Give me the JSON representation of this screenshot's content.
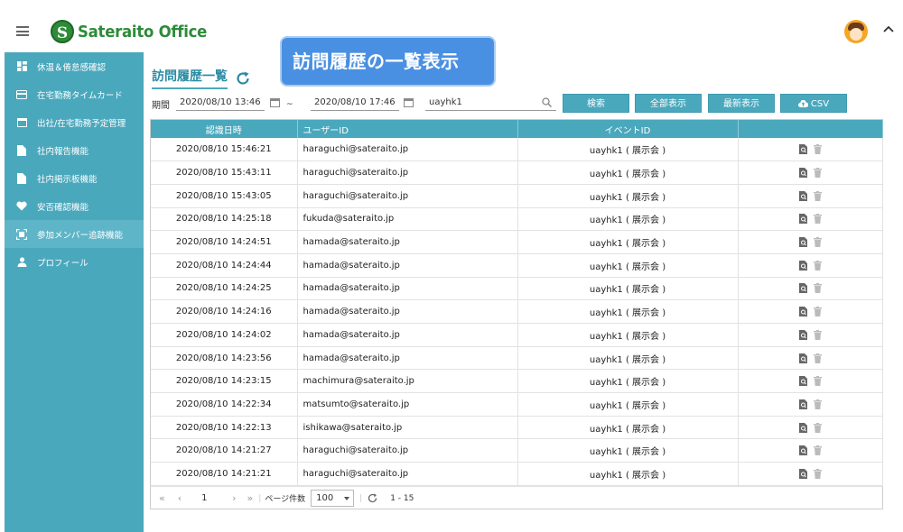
{
  "header": {
    "logo_text": "Sateraito Office",
    "logo_letter": "S"
  },
  "banner": {
    "text": "訪問履歴の一覧表示"
  },
  "sidebar": {
    "items": [
      {
        "label": "休温＆倦怠感確認",
        "icon": "dashboard-icon"
      },
      {
        "label": "在宅勤務タイムカード",
        "icon": "card-icon"
      },
      {
        "label": "出社/在宅勤務予定管理",
        "icon": "calendar-icon"
      },
      {
        "label": "社内報告機能",
        "icon": "document-icon"
      },
      {
        "label": "社内掲示板機能",
        "icon": "document-icon"
      },
      {
        "label": "安否確認機能",
        "icon": "heart-icon"
      },
      {
        "label": "参加メンバー追跡機能",
        "icon": "qr-scan-icon"
      },
      {
        "label": "プロフィール",
        "icon": "person-icon"
      }
    ],
    "active_index": 6
  },
  "main": {
    "title": "訪問履歴一覧",
    "filters": {
      "label": "期間",
      "date_from": "2020/08/10 13:46",
      "date_to": "2020/08/10 17:46",
      "keyword": "uayhk1",
      "separator": "~",
      "search_button": "検索",
      "show_all_button": "全部表示",
      "latest_button": "最新表示",
      "csv_button": "CSV"
    },
    "table": {
      "columns": [
        "認識日時",
        "ユーザーID",
        "イベントID",
        ""
      ],
      "rows": [
        [
          "2020/08/10 15:46:21",
          "haraguchi@sateraito.jp",
          "uayhk1 ( 展示会 )"
        ],
        [
          "2020/08/10 15:43:11",
          "haraguchi@sateraito.jp",
          "uayhk1 ( 展示会 )"
        ],
        [
          "2020/08/10 15:43:05",
          "haraguchi@sateraito.jp",
          "uayhk1 ( 展示会 )"
        ],
        [
          "2020/08/10 14:25:18",
          "fukuda@sateraito.jp",
          "uayhk1 ( 展示会 )"
        ],
        [
          "2020/08/10 14:24:51",
          "hamada@sateraito.jp",
          "uayhk1 ( 展示会 )"
        ],
        [
          "2020/08/10 14:24:44",
          "hamada@sateraito.jp",
          "uayhk1 ( 展示会 )"
        ],
        [
          "2020/08/10 14:24:25",
          "hamada@sateraito.jp",
          "uayhk1 ( 展示会 )"
        ],
        [
          "2020/08/10 14:24:16",
          "hamada@sateraito.jp",
          "uayhk1 ( 展示会 )"
        ],
        [
          "2020/08/10 14:24:02",
          "hamada@sateraito.jp",
          "uayhk1 ( 展示会 )"
        ],
        [
          "2020/08/10 14:23:56",
          "hamada@sateraito.jp",
          "uayhk1 ( 展示会 )"
        ],
        [
          "2020/08/10 14:23:15",
          "machimura@sateraito.jp",
          "uayhk1 ( 展示会 )"
        ],
        [
          "2020/08/10 14:22:34",
          "matsumto@sateraito.jp",
          "uayhk1 ( 展示会 )"
        ],
        [
          "2020/08/10 14:22:13",
          "ishikawa@sateraito.jp",
          "uayhk1 ( 展示会 )"
        ],
        [
          "2020/08/10 14:21:27",
          "haraguchi@sateraito.jp",
          "uayhk1 ( 展示会 )"
        ],
        [
          "2020/08/10 14:21:21",
          "haraguchi@sateraito.jp",
          "uayhk1 ( 展示会 )"
        ]
      ]
    },
    "pager": {
      "page": "1",
      "page_size_label": "ページ件数",
      "page_size": "100",
      "range": "1 - 15"
    }
  },
  "colors": {
    "accent": "#4aa8bd",
    "brand_green": "#2e8b3a",
    "banner_blue": "#4a90e2"
  }
}
